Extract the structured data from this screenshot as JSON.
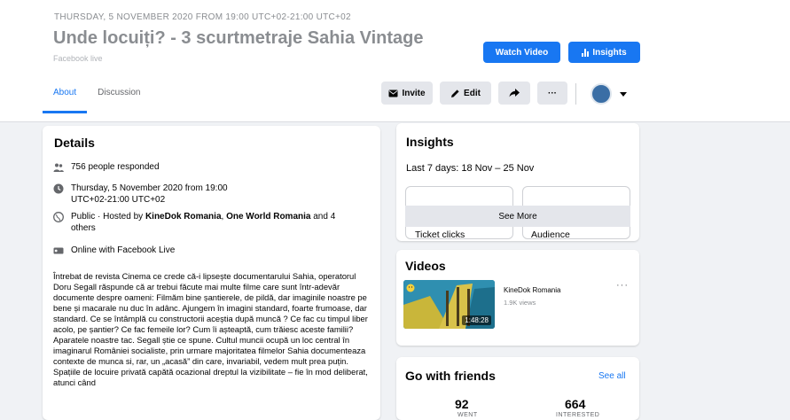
{
  "header": {
    "date_line": "THURSDAY, 5 NOVEMBER 2020 FROM 19:00 UTC+02-21:00 UTC+02",
    "title": "Unde locuiți? - 3 scurtmetraje Sahia Vintage",
    "subtitle": "Facebook live",
    "watch_video_label": "Watch Video",
    "insights_label": "Insights"
  },
  "tabs": {
    "about": "About",
    "discussion": "Discussion"
  },
  "toolbar": {
    "invite_label": "Invite",
    "edit_label": "Edit",
    "more_label": "···"
  },
  "details": {
    "title": "Details",
    "responded": "756 people responded",
    "datetime": "Thursday, 5 November 2020 from 19:00 UTC+02-21:00 UTC+02",
    "hosted_prefix": "Public · Hosted by ",
    "host1": "KineDok Romania",
    "host_sep": ", ",
    "host2": "One World Romania",
    "hosted_suffix": " and 4 others",
    "online": "Online with Facebook Live",
    "description": "Întrebat de revista Cinema ce crede că-i lipsește documentarului Sahia, operatorul Doru Segall răspunde că ar trebui făcute mai multe filme care sunt într-adevăr documente despre oameni: Filmăm bine șantierele, de pildă, dar imaginile noastre pe bene și macarale nu duc în adânc. Ajungem în imagini standard, foarte frumoase, dar standard. Ce se întâmplă cu constructorii aceștia după muncă ? Ce fac cu timpul liber acolo, pe șantier? Ce fac femeile lor? Cum îi așteaptă, cum trăiesc aceste familii? Aparatele noastre tac. Segall știe ce spune. Cultul muncii ocupă un loc central în imaginarul României socialiste, prin urmare majoritatea filmelor Sahia documenteaza contexte de munca si, rar, un „acasă” din care, invariabil, vedem mult prea puțin. Spațiile de locuire privată capătă ocazional dreptul la vizibilitate – fie în mod deliberat, atunci când"
  },
  "insights": {
    "title": "Insights",
    "range": "Last 7 days: 18 Nov – 25 Nov",
    "ticket_clicks": "Ticket clicks",
    "audience": "Audience",
    "see_more": "See More"
  },
  "videos": {
    "title": "Videos",
    "author": "KineDok Romania",
    "views": "1.9K views",
    "duration": "1:48:28",
    "more": "···"
  },
  "friends": {
    "title": "Go with friends",
    "see_all": "See all",
    "went_count": "92",
    "went_label": "WENT",
    "interested_count": "664",
    "interested_label": "INTERESTED"
  },
  "colors": {
    "accent": "#1877f2",
    "page_bg": "#f0f2f5",
    "button_gray": "#e4e6eb",
    "muted_text": "#65676b"
  },
  "icons": [
    "bar-chart-icon",
    "envelope-icon",
    "pencil-icon",
    "share-arrow-icon",
    "people-icon",
    "clock-icon",
    "globe-icon",
    "video-camera-icon",
    "caret-down-icon",
    "thumbnail-emoji-icon"
  ]
}
